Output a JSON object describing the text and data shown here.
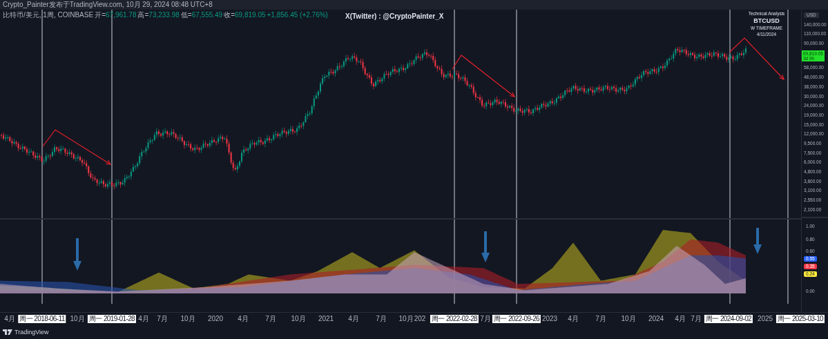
{
  "header": {
    "title": "Crypto_Painter发布于TradingView.com, 10月 29, 2024 08:48 UTC+8"
  },
  "legend": {
    "symbol": "比特币/美元, 1周, COINBASE",
    "values": [
      {
        "label": "开=",
        "value": "67,961.78"
      },
      {
        "label": "高=",
        "value": "73,233.98"
      },
      {
        "label": "低=",
        "value": "67,555.49"
      },
      {
        "label": "收=",
        "value": "69,819.05"
      }
    ],
    "change": "+1,856.45 (+2.76%)"
  },
  "author_note": "X(Twitter) : @CryptoPainter_X",
  "annotation": [
    "Technical Analysis",
    "BTCUSD",
    "W TIMEFRAME",
    "4/11/2024"
  ],
  "price_axis": {
    "currency": "USD",
    "ticks": [
      "140,000.00",
      "110,000.00",
      "90,000.00",
      "58,000.00",
      "48,000.00",
      "38,000.00",
      "30,000.00",
      "24,000.00",
      "19,000.00",
      "15,000.00",
      "12,000.00",
      "9,500.00",
      "7,500.00",
      "6,000.00",
      "4,800.00",
      "3,800.00",
      "3,100.00",
      "2,550.00",
      "2,100.00"
    ],
    "last_price": {
      "value": "69,819.05",
      "countdown": "3d 9h"
    }
  },
  "indicator_axis": {
    "ticks": [
      "1.00",
      "0.80",
      "0.60",
      "0.00"
    ],
    "values": [
      {
        "value": "0.55",
        "color": "#2962ff"
      },
      {
        "value": "0.35",
        "color": "#f23645"
      },
      {
        "value": "0.24",
        "color": "#ffeb3b"
      }
    ]
  },
  "time_axis": [
    {
      "label": "4月",
      "kind": "tick"
    },
    {
      "label": "周一 2018-06-11",
      "kind": "marker"
    },
    {
      "label": "10月",
      "kind": "tick"
    },
    {
      "label": "周一 2019-01-28",
      "kind": "marker"
    },
    {
      "label": "4月",
      "kind": "tick"
    },
    {
      "label": "7月",
      "kind": "tick"
    },
    {
      "label": "10月",
      "kind": "tick"
    },
    {
      "label": "2020",
      "kind": "tick"
    },
    {
      "label": "4月",
      "kind": "tick"
    },
    {
      "label": "7月",
      "kind": "tick"
    },
    {
      "label": "10月",
      "kind": "tick"
    },
    {
      "label": "2021",
      "kind": "tick"
    },
    {
      "label": "4月",
      "kind": "tick"
    },
    {
      "label": "7月",
      "kind": "tick"
    },
    {
      "label": "10月",
      "kind": "tick"
    },
    {
      "label": "202",
      "kind": "tick"
    },
    {
      "label": "周一 2022-02-28",
      "kind": "marker"
    },
    {
      "label": "7月",
      "kind": "tick"
    },
    {
      "label": "周一 2022-09-26",
      "kind": "marker"
    },
    {
      "label": "2023",
      "kind": "tick"
    },
    {
      "label": "4月",
      "kind": "tick"
    },
    {
      "label": "7月",
      "kind": "tick"
    },
    {
      "label": "10月",
      "kind": "tick"
    },
    {
      "label": "2024",
      "kind": "tick"
    },
    {
      "label": "4月",
      "kind": "tick"
    },
    {
      "label": "7月",
      "kind": "tick"
    },
    {
      "label": "周一 2024-09-02",
      "kind": "marker"
    },
    {
      "label": "2025",
      "kind": "tick"
    },
    {
      "label": "周一 2025-03-10",
      "kind": "marker"
    }
  ],
  "footer": {
    "brand": "TradingView"
  }
}
